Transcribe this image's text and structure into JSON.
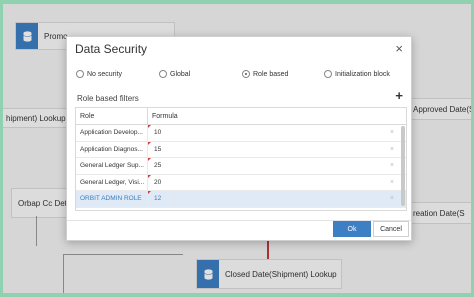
{
  "background": {
    "nodes": {
      "top_node": "Promo",
      "shipment_lookup_left": "hipment) Lookup",
      "approved_date": "Approved Date(S",
      "orbap_cc": "Orbap Cc Deta",
      "creation_date": "reation Date(S",
      "closed_date": "Closed Date(Shipment) Lookup"
    }
  },
  "dialog": {
    "title": "Data Security",
    "close_glyph": "×",
    "radios": [
      {
        "label": "No security",
        "selected": false
      },
      {
        "label": "Global",
        "selected": false
      },
      {
        "label": "Role based",
        "selected": true
      },
      {
        "label": "Initialization block",
        "selected": false
      }
    ],
    "section_title": "Role based filters",
    "add_glyph": "+",
    "table": {
      "headers": {
        "role": "Role",
        "formula": "Formula"
      },
      "rows": [
        {
          "role": "Application Develop...",
          "formula": "10",
          "selected": false
        },
        {
          "role": "Application Diagnos...",
          "formula": "15",
          "selected": false
        },
        {
          "role": "General Ledger Sup...",
          "formula": "25",
          "selected": false
        },
        {
          "role": "General Ledger, Visi...",
          "formula": "20",
          "selected": false
        },
        {
          "role": "ORBIT ADMIN ROLE",
          "formula": "12",
          "selected": true
        }
      ],
      "delete_glyph": "×"
    },
    "ok_label": "Ok",
    "cancel_label": "Cancel"
  },
  "colors": {
    "accent": "#3d7fc4",
    "frame": "#8fd1b0",
    "selected_row": "#dfeaf6",
    "marker": "#d23b3b"
  }
}
